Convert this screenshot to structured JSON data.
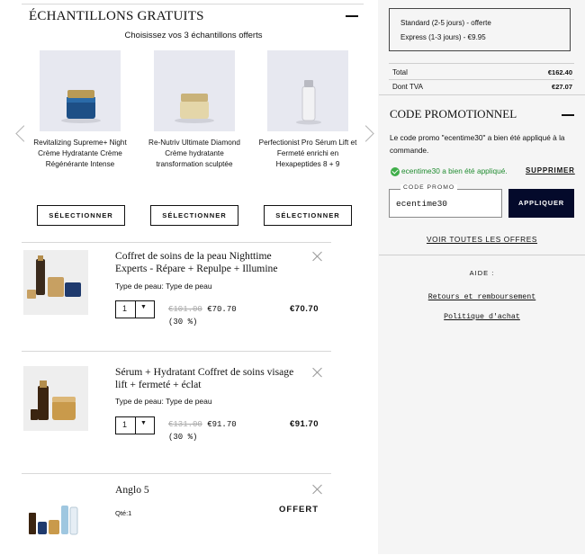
{
  "samples": {
    "title": "ÉCHANTILLONS GRATUITS",
    "subtitle": "Choisissez vos 3 échantillons offerts",
    "items": [
      {
        "name": "Revitalizing Supreme+ Night Crème Hydratante Crème Régénérante Intense",
        "button": "SÉLECTIONNER",
        "icon": "blue-jar-icon"
      },
      {
        "name": "Re-Nutriv Ultimate Diamond Crème hydratante transformation sculptée",
        "button": "SÉLECTIONNER",
        "icon": "gold-jar-icon"
      },
      {
        "name": "Perfectionist Pro Sérum Lift et Fermeté enrichi en Hexapeptides 8 + 9",
        "button": "SÉLECTIONNER",
        "icon": "serum-bottle-icon"
      }
    ]
  },
  "cart": {
    "items": [
      {
        "name": "Coffret de soins de la peau Nighttime Experts - Répare + Repulpe + Illumine",
        "skin_type": "Type de peau: Type de peau",
        "quantity": "1",
        "old_price": "€101.00",
        "new_price": "€70.70",
        "discount": "(30 %)",
        "total": "€70.70"
      },
      {
        "name": "Sérum + Hydratant Coffret de soins visage lift + fermeté + éclat",
        "skin_type": "Type de peau: Type de peau",
        "quantity": "1",
        "old_price": "€131.00",
        "new_price": "€91.70",
        "discount": "(30 %)",
        "total": "€91.70"
      },
      {
        "name": "Anglo 5",
        "qty_text": "Qté:1",
        "total": "OFFERT"
      }
    ]
  },
  "shipping": {
    "standard": "Standard (2-5 jours) - offerte",
    "express": "Express (1-3 jours) - €9.95"
  },
  "summary": {
    "total_label": "Total",
    "total_value": "€162.40",
    "vat_label": "Dont TVA",
    "vat_value": "€27.07"
  },
  "promo": {
    "title": "CODE PROMOTIONNEL",
    "message": "Le code promo \"ecentime30\" a bien été appliqué à la commande.",
    "success": "ecentime30 a bien été appliqué.",
    "remove": "SUPPRIMER",
    "field_label": "CODE PROMO",
    "field_value": "ecentime30",
    "apply": "APPLIQUER",
    "all_offers": "VOIR TOUTES LES OFFRES"
  },
  "help": {
    "title": "AIDE :",
    "returns": "Retours et remboursement",
    "policy": "Politique d'achat"
  },
  "colors": {
    "apply_button": "#040a2b",
    "success_green": "#3fae49",
    "panel_bg": "#f5f5f5"
  }
}
